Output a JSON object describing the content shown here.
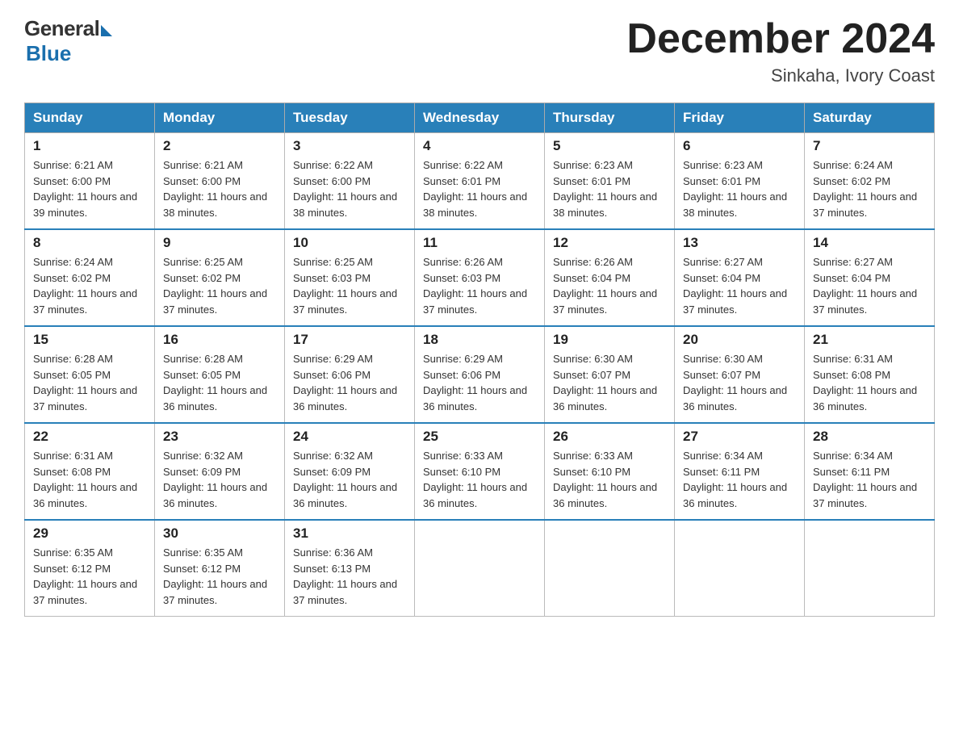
{
  "header": {
    "logo": {
      "general": "General",
      "blue": "Blue",
      "tagline": "Blue"
    },
    "title": "December 2024",
    "location": "Sinkaha, Ivory Coast"
  },
  "calendar": {
    "days_of_week": [
      "Sunday",
      "Monday",
      "Tuesday",
      "Wednesday",
      "Thursday",
      "Friday",
      "Saturday"
    ],
    "weeks": [
      [
        {
          "day": "1",
          "sunrise": "6:21 AM",
          "sunset": "6:00 PM",
          "daylight": "11 hours and 39 minutes."
        },
        {
          "day": "2",
          "sunrise": "6:21 AM",
          "sunset": "6:00 PM",
          "daylight": "11 hours and 38 minutes."
        },
        {
          "day": "3",
          "sunrise": "6:22 AM",
          "sunset": "6:00 PM",
          "daylight": "11 hours and 38 minutes."
        },
        {
          "day": "4",
          "sunrise": "6:22 AM",
          "sunset": "6:01 PM",
          "daylight": "11 hours and 38 minutes."
        },
        {
          "day": "5",
          "sunrise": "6:23 AM",
          "sunset": "6:01 PM",
          "daylight": "11 hours and 38 minutes."
        },
        {
          "day": "6",
          "sunrise": "6:23 AM",
          "sunset": "6:01 PM",
          "daylight": "11 hours and 38 minutes."
        },
        {
          "day": "7",
          "sunrise": "6:24 AM",
          "sunset": "6:02 PM",
          "daylight": "11 hours and 37 minutes."
        }
      ],
      [
        {
          "day": "8",
          "sunrise": "6:24 AM",
          "sunset": "6:02 PM",
          "daylight": "11 hours and 37 minutes."
        },
        {
          "day": "9",
          "sunrise": "6:25 AM",
          "sunset": "6:02 PM",
          "daylight": "11 hours and 37 minutes."
        },
        {
          "day": "10",
          "sunrise": "6:25 AM",
          "sunset": "6:03 PM",
          "daylight": "11 hours and 37 minutes."
        },
        {
          "day": "11",
          "sunrise": "6:26 AM",
          "sunset": "6:03 PM",
          "daylight": "11 hours and 37 minutes."
        },
        {
          "day": "12",
          "sunrise": "6:26 AM",
          "sunset": "6:04 PM",
          "daylight": "11 hours and 37 minutes."
        },
        {
          "day": "13",
          "sunrise": "6:27 AM",
          "sunset": "6:04 PM",
          "daylight": "11 hours and 37 minutes."
        },
        {
          "day": "14",
          "sunrise": "6:27 AM",
          "sunset": "6:04 PM",
          "daylight": "11 hours and 37 minutes."
        }
      ],
      [
        {
          "day": "15",
          "sunrise": "6:28 AM",
          "sunset": "6:05 PM",
          "daylight": "11 hours and 37 minutes."
        },
        {
          "day": "16",
          "sunrise": "6:28 AM",
          "sunset": "6:05 PM",
          "daylight": "11 hours and 36 minutes."
        },
        {
          "day": "17",
          "sunrise": "6:29 AM",
          "sunset": "6:06 PM",
          "daylight": "11 hours and 36 minutes."
        },
        {
          "day": "18",
          "sunrise": "6:29 AM",
          "sunset": "6:06 PM",
          "daylight": "11 hours and 36 minutes."
        },
        {
          "day": "19",
          "sunrise": "6:30 AM",
          "sunset": "6:07 PM",
          "daylight": "11 hours and 36 minutes."
        },
        {
          "day": "20",
          "sunrise": "6:30 AM",
          "sunset": "6:07 PM",
          "daylight": "11 hours and 36 minutes."
        },
        {
          "day": "21",
          "sunrise": "6:31 AM",
          "sunset": "6:08 PM",
          "daylight": "11 hours and 36 minutes."
        }
      ],
      [
        {
          "day": "22",
          "sunrise": "6:31 AM",
          "sunset": "6:08 PM",
          "daylight": "11 hours and 36 minutes."
        },
        {
          "day": "23",
          "sunrise": "6:32 AM",
          "sunset": "6:09 PM",
          "daylight": "11 hours and 36 minutes."
        },
        {
          "day": "24",
          "sunrise": "6:32 AM",
          "sunset": "6:09 PM",
          "daylight": "11 hours and 36 minutes."
        },
        {
          "day": "25",
          "sunrise": "6:33 AM",
          "sunset": "6:10 PM",
          "daylight": "11 hours and 36 minutes."
        },
        {
          "day": "26",
          "sunrise": "6:33 AM",
          "sunset": "6:10 PM",
          "daylight": "11 hours and 36 minutes."
        },
        {
          "day": "27",
          "sunrise": "6:34 AM",
          "sunset": "6:11 PM",
          "daylight": "11 hours and 36 minutes."
        },
        {
          "day": "28",
          "sunrise": "6:34 AM",
          "sunset": "6:11 PM",
          "daylight": "11 hours and 37 minutes."
        }
      ],
      [
        {
          "day": "29",
          "sunrise": "6:35 AM",
          "sunset": "6:12 PM",
          "daylight": "11 hours and 37 minutes."
        },
        {
          "day": "30",
          "sunrise": "6:35 AM",
          "sunset": "6:12 PM",
          "daylight": "11 hours and 37 minutes."
        },
        {
          "day": "31",
          "sunrise": "6:36 AM",
          "sunset": "6:13 PM",
          "daylight": "11 hours and 37 minutes."
        },
        null,
        null,
        null,
        null
      ]
    ]
  }
}
